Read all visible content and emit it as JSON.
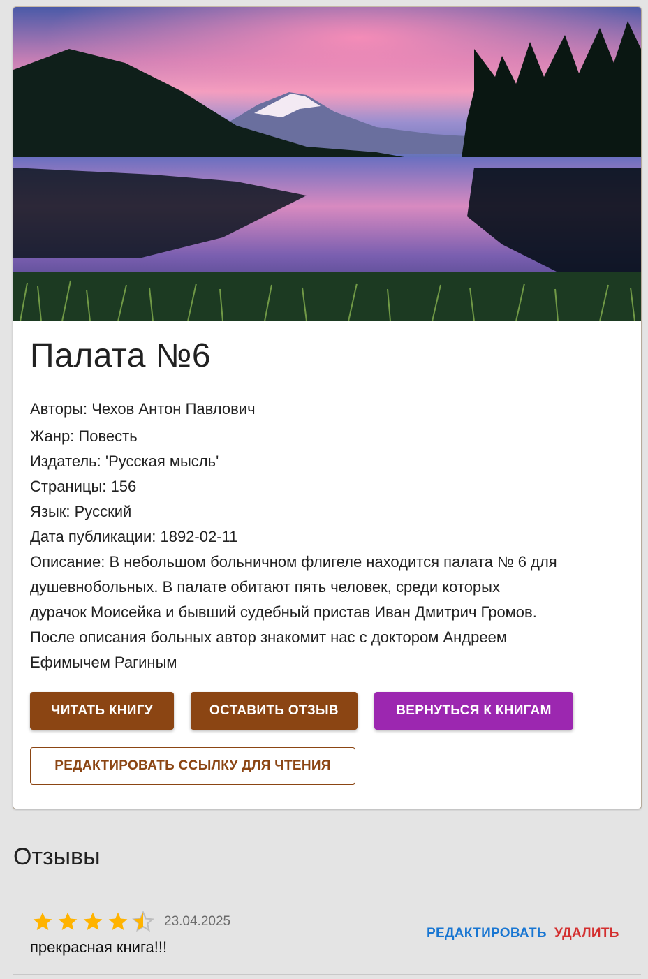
{
  "book": {
    "title": "Палата №6",
    "authors": "Авторы: Чехов Антон Павлович",
    "genre": "Жанр: Повесть",
    "publisher": "Издатель: 'Русская мысль'",
    "pages": "Страницы: 156",
    "language": "Язык: Русский",
    "published": "Дата публикации: 1892-02-11",
    "description_lines": [
      "Описание: В небольшом больничном флигеле находится палата № 6 для",
      "душевнобольных. В палате обитают пять человек, среди которых",
      "дурачок Моисейка и бывший судебный пристав Иван Дмитрич Громов.",
      "После описания больных автор знакомит нас с доктором Андреем",
      "Ефимычем Рагиным"
    ]
  },
  "actions": {
    "read": "ЧИТАТЬ КНИГУ",
    "review": "ОСТАВИТЬ ОТЗЫВ",
    "back": "ВЕРНУТЬСЯ К КНИГАМ",
    "edit_link": "РЕДАКТИРОВАТЬ ССЫЛКУ ДЛЯ ЧТЕНИЯ"
  },
  "reviews": {
    "heading": "Отзывы",
    "items": [
      {
        "rating": 4.5,
        "max_rating": 5,
        "date": "23.04.2025",
        "text": "прекрасная книга!!!",
        "edit_label": "РЕДАКТИРОВАТЬ",
        "delete_label": "УДАЛИТЬ"
      }
    ]
  },
  "icons": {
    "star_filled": "star-icon",
    "star_half": "star-half-icon"
  },
  "colors": {
    "primary_brown": "#8b4513",
    "accent_purple": "#9c27b0",
    "link_blue": "#1976d2",
    "danger_red": "#d32f2f",
    "star_gold": "#ffb300",
    "star_empty": "#bdbdbd"
  }
}
